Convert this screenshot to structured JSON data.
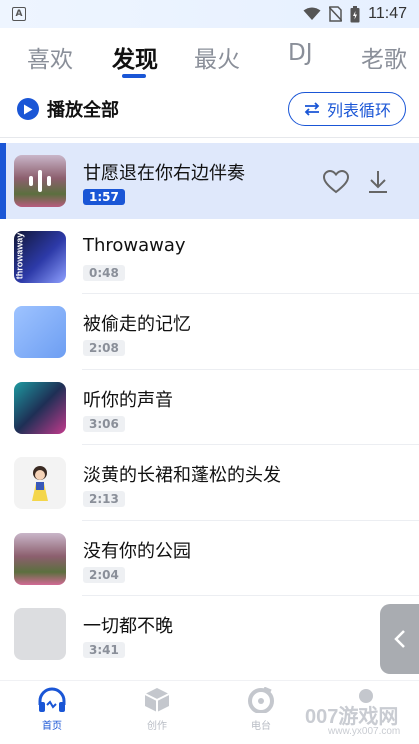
{
  "status_bar": {
    "time": "11:47"
  },
  "tabs": [
    {
      "label": "喜欢"
    },
    {
      "label": "发现"
    },
    {
      "label": "最火"
    },
    {
      "label": "DJ"
    },
    {
      "label": "老歌"
    }
  ],
  "active_tab": "发现",
  "controls": {
    "play_all_label": "播放全部",
    "loop_label": "列表循环"
  },
  "songs": [
    {
      "title": "甘愿退在你右边伴奏",
      "duration": "1:57",
      "playing": true
    },
    {
      "title": "Throwaway",
      "duration": "0:48",
      "cover_text": "throwaway"
    },
    {
      "title": "被偷走的记忆",
      "duration": "2:08"
    },
    {
      "title": "听你的声音",
      "duration": "3:06"
    },
    {
      "title": "淡黄的长裙和蓬松的头发",
      "duration": "2:13"
    },
    {
      "title": "没有你的公园",
      "duration": "2:04"
    },
    {
      "title": "一切都不晚",
      "duration": "3:41"
    }
  ],
  "bottom_nav": [
    {
      "label": "首页",
      "icon": "headphones-icon",
      "active": true
    },
    {
      "label": "创作",
      "icon": "cube-icon"
    },
    {
      "label": "电台",
      "icon": "radio-disc-icon"
    },
    {
      "label": "",
      "icon": "profile-icon"
    }
  ],
  "watermark": {
    "text": "007游戏网",
    "url": "www.yx007.com"
  },
  "colors": {
    "accent": "#1a56d6",
    "active_row": "#dfe8fb",
    "muted": "#8a8f99"
  }
}
